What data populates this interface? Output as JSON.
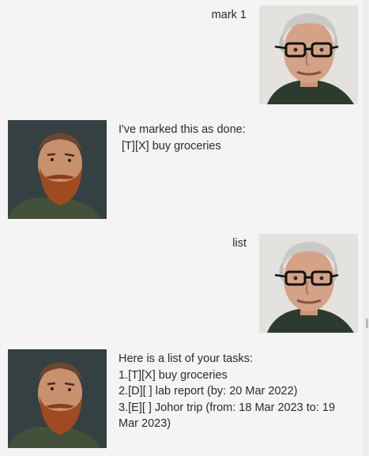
{
  "messages": [
    {
      "sender": "user",
      "avatar_icon": "older-man-glasses-avatar",
      "lines": [
        "mark 1"
      ]
    },
    {
      "sender": "bot",
      "avatar_icon": "bearded-man-avatar",
      "lines": [
        "I've marked this as done:",
        " [T][X] buy groceries"
      ]
    },
    {
      "sender": "user",
      "avatar_icon": "older-man-glasses-avatar",
      "lines": [
        "list"
      ]
    },
    {
      "sender": "bot",
      "avatar_icon": "bearded-man-avatar",
      "lines": [
        "Here is a list of your tasks:",
        "1.[T][X] buy groceries",
        "2.[D][ ] lab report (by: 20 Mar 2022)",
        "3.[E][ ] Johor trip (from: 18 Mar 2023 to: 19",
        "Mar 2023)"
      ]
    }
  ]
}
